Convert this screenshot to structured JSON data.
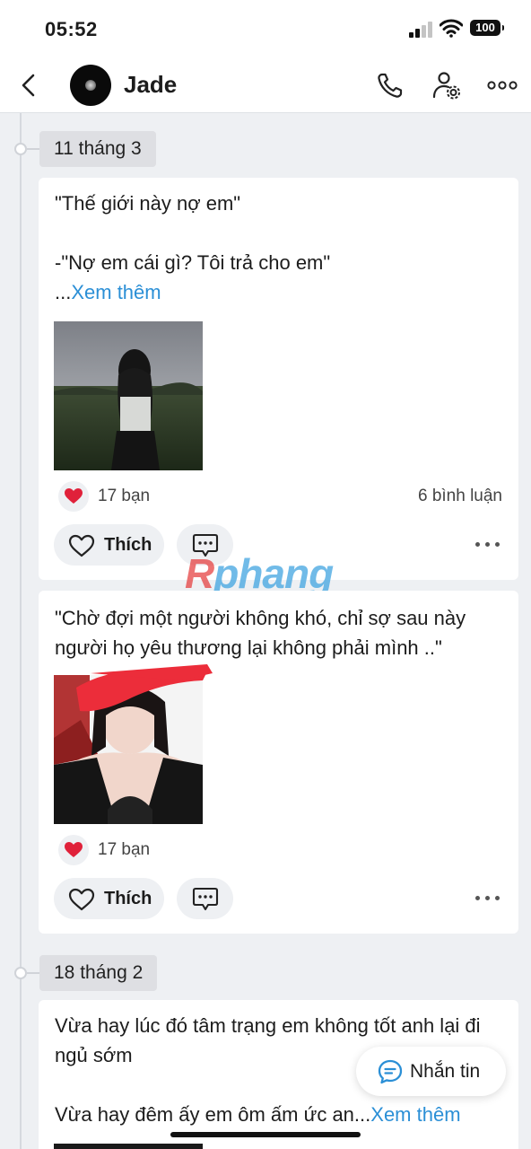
{
  "status_bar": {
    "time": "05:52",
    "battery": "100"
  },
  "header": {
    "name": "Jade"
  },
  "icons": [
    "back-icon",
    "call-icon",
    "profile-settings-icon",
    "more-icon",
    "heart-icon",
    "like-icon",
    "comment-icon",
    "chat-icon"
  ],
  "timeline": {
    "groups": [
      {
        "date": "11 tháng 3",
        "posts": [
          {
            "text": "\"Thế giới này nợ em\"\n\n-\"Nợ em cái gì? Tôi trả cho em\"",
            "ellipsis": "...",
            "see_more": "Xem thêm",
            "reactions": "17 bạn",
            "comments": "6 bình luận",
            "like_label": "Thích"
          },
          {
            "text": "\"Chờ đợi một người không khó, chỉ sợ sau này người họ yêu thương lại không phải mình ..\"",
            "reactions": "17 bạn",
            "like_label": "Thích"
          }
        ]
      },
      {
        "date": "18 tháng 2",
        "posts": [
          {
            "text": "Vừa hay lúc đó tâm trạng em không tốt anh lại đi ngủ sớm\n\nVừa hay đêm ấy em ôm ấm ức an...",
            "see_more": "Xem thêm"
          }
        ]
      }
    ]
  },
  "watermark": {
    "first": "R",
    "rest": "phang"
  },
  "chat_button": {
    "label": "Nhắn tin"
  },
  "colors": {
    "link": "#2b8fd6",
    "heart": "#e0213a",
    "background": "#eef0f3"
  }
}
